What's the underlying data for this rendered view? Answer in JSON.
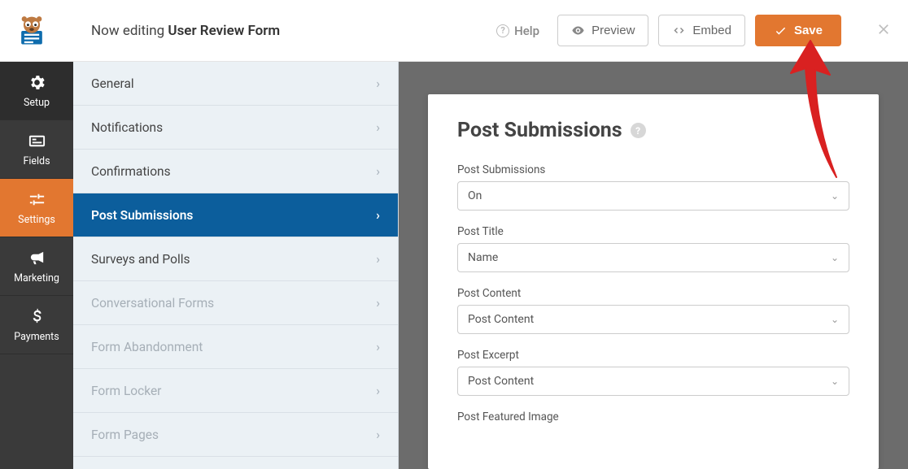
{
  "header": {
    "now_editing": "Now editing",
    "form_name": "User Review Form",
    "help": "Help",
    "preview": "Preview",
    "embed": "Embed",
    "save": "Save"
  },
  "sidebar": {
    "setup": "Setup",
    "fields": "Fields",
    "settings": "Settings",
    "marketing": "Marketing",
    "payments": "Payments"
  },
  "settings_menu": [
    "General",
    "Notifications",
    "Confirmations",
    "Post Submissions",
    "Surveys and Polls",
    "Conversational Forms",
    "Form Abandonment",
    "Form Locker",
    "Form Pages"
  ],
  "panel": {
    "title": "Post Submissions",
    "fields": [
      {
        "label": "Post Submissions",
        "value": "On"
      },
      {
        "label": "Post Title",
        "value": "Name"
      },
      {
        "label": "Post Content",
        "value": "Post Content"
      },
      {
        "label": "Post Excerpt",
        "value": "Post Content"
      },
      {
        "label": "Post Featured Image",
        "value": ""
      }
    ]
  }
}
